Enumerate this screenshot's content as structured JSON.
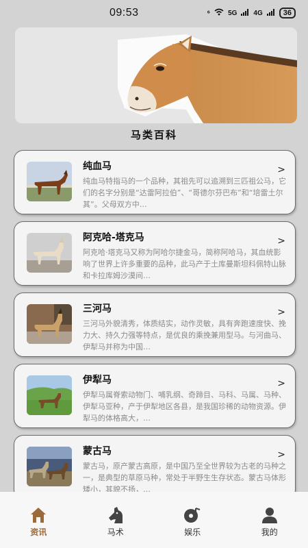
{
  "status": {
    "time": "09:53",
    "net1": "5G",
    "net2": "4G",
    "battery": "36"
  },
  "header": {
    "title": "马类百科"
  },
  "horses": [
    {
      "name": "纯血马",
      "desc": "纯血马特指马的一个品种，其祖先可以追溯到三匹祖公马，它们的名字分别是“达雷阿拉伯”、“哥德尔芬巴布”和“培雷土尔其”。父母双方中…",
      "image": "thoroughbred-horse-photo"
    },
    {
      "name": "阿克哈-塔克马",
      "desc": "阿克哈·塔克马又称为阿哈尔捷金马，简称阿哈马，其血统影响了世界上许多重要的品种，此马产于土库曼斯坦科佩特山脉和卡拉库姆沙漠间…",
      "image": "akhal-teke-horse-photo"
    },
    {
      "name": "三河马",
      "desc": "三河马外貌清秀，体质结实，动作灵敏，具有奔跑速度快、挽力大、持久力强等特点，是优良的乘挽兼用型马。与河曲马、伊犁马并称为中国…",
      "image": "sanhe-horse-photo"
    },
    {
      "name": "伊犁马",
      "desc": "伊犁马属脊索动物门、哺乳纲、奇蹄目、马科、马属、马种、伊犁马亚种，产于伊犁地区各县，是我国珍稀的动物资源。伊犁马的体格高大，…",
      "image": "yili-horse-photo"
    },
    {
      "name": "蒙古马",
      "desc": "蒙古马，原产蒙古高原，是中国乃至全世界较为古老的马种之一，是典型的草原马种，常处于半野生生存状态。蒙古马体形矮小，其貌不扬，…",
      "image": "mongolian-horse-photo"
    }
  ],
  "tabs": [
    {
      "label": "资讯",
      "icon": "home-icon",
      "active": true
    },
    {
      "label": "马术",
      "icon": "horse-head-icon",
      "active": false
    },
    {
      "label": "娱乐",
      "icon": "music-disc-icon",
      "active": false
    },
    {
      "label": "我的",
      "icon": "user-icon",
      "active": false
    }
  ],
  "colors": {
    "background": "#d3d3d3",
    "accent": "#9b6a3a",
    "card": "#f4f4f4"
  }
}
